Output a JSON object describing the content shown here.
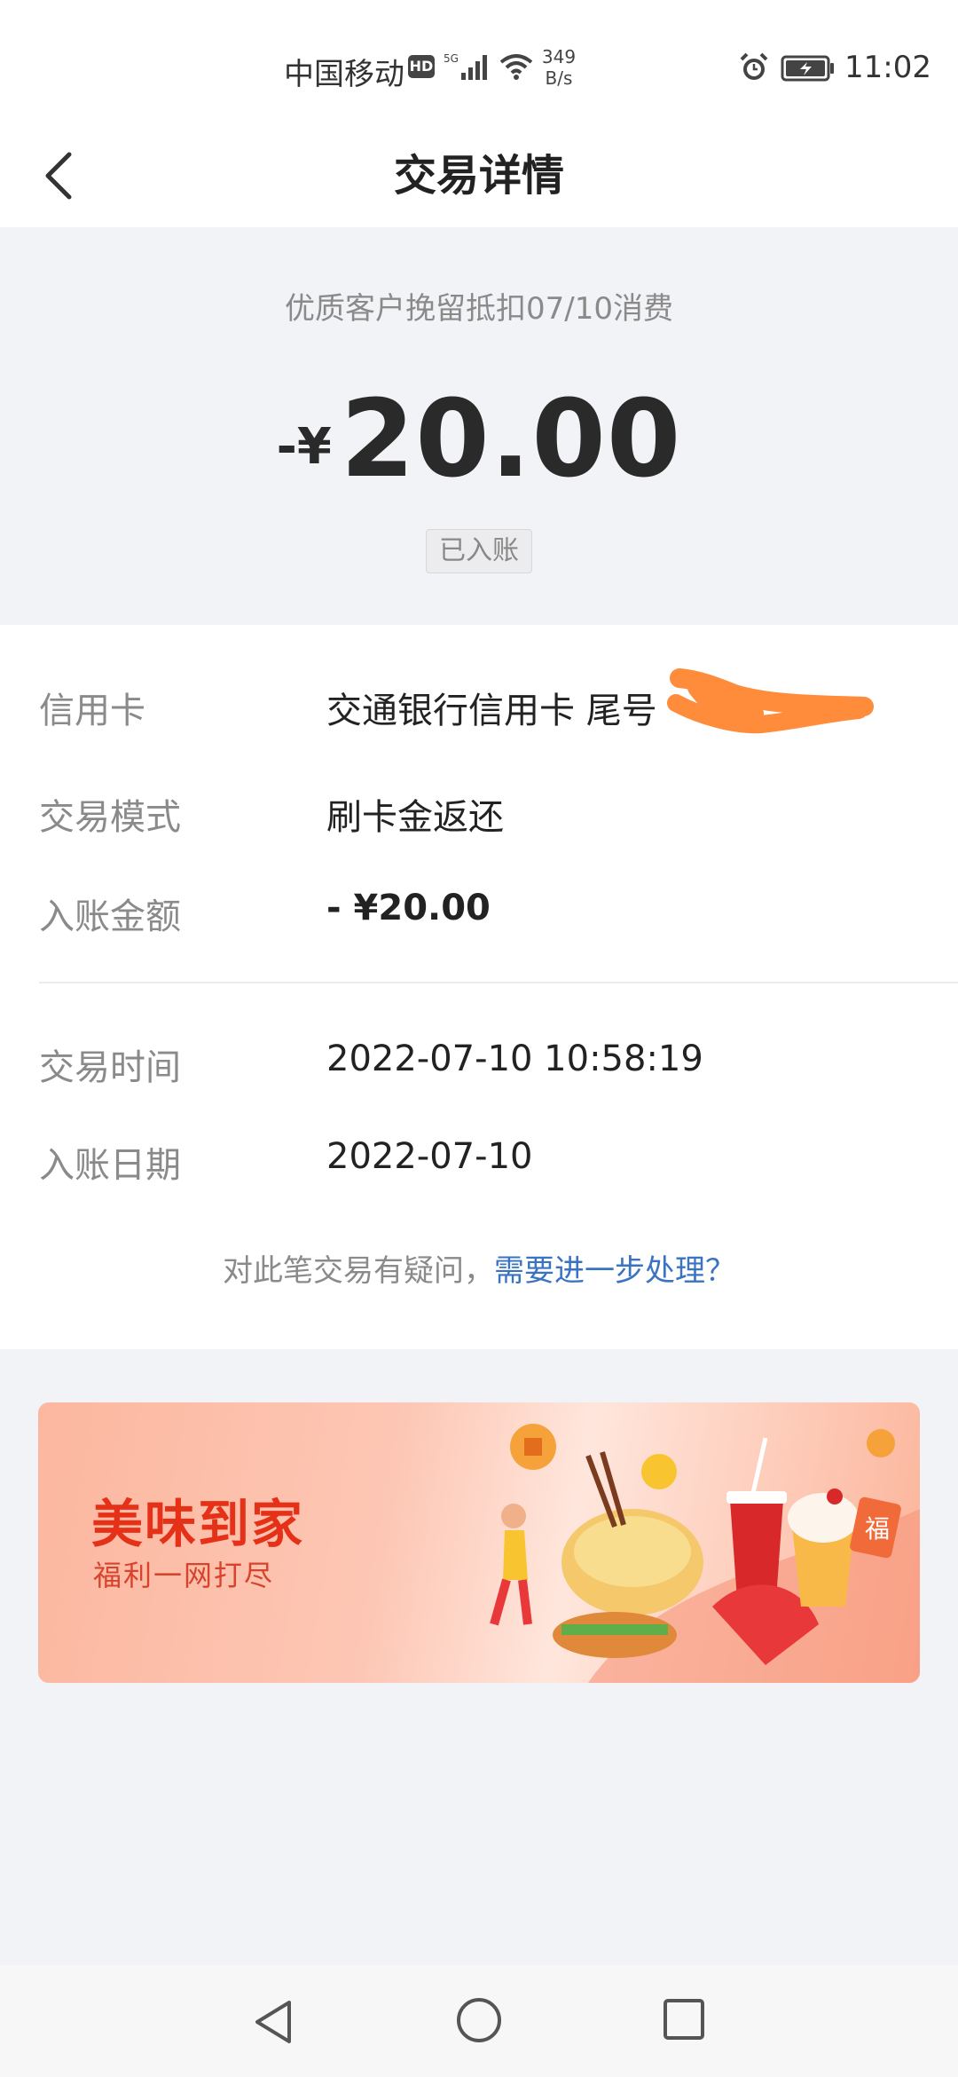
{
  "status_bar": {
    "carrier": "中国移动",
    "hd_badge": "HD",
    "network_type": "5G",
    "net_speed_value": "349",
    "net_speed_unit": "B/s",
    "time": "11:02"
  },
  "header": {
    "title": "交易详情"
  },
  "summary": {
    "description": "优质客户挽留抵扣07/10消费",
    "amount_prefix": "-¥",
    "amount": "20.00",
    "status": "已入账"
  },
  "details": {
    "rows": [
      {
        "label": "信用卡",
        "value": "交通银行信用卡 尾号"
      },
      {
        "label": "交易模式",
        "value": "刷卡金返还"
      },
      {
        "label": "入账金额",
        "value": "- ¥20.00"
      },
      {
        "label": "交易时间",
        "value": "2022-07-10 10:58:19"
      },
      {
        "label": "入账日期",
        "value": "2022-07-10"
      }
    ]
  },
  "query": {
    "text": "对此笔交易有疑问，",
    "link": "需要进一步处理？"
  },
  "banner": {
    "title": "美味到家",
    "subtitle": "福利一网打尽",
    "badge_char": "福"
  },
  "colors": {
    "link": "#3a73c2",
    "banner_title": "#e63119",
    "redaction": "#ff8c3a",
    "page_bg": "#f2f3f7"
  }
}
